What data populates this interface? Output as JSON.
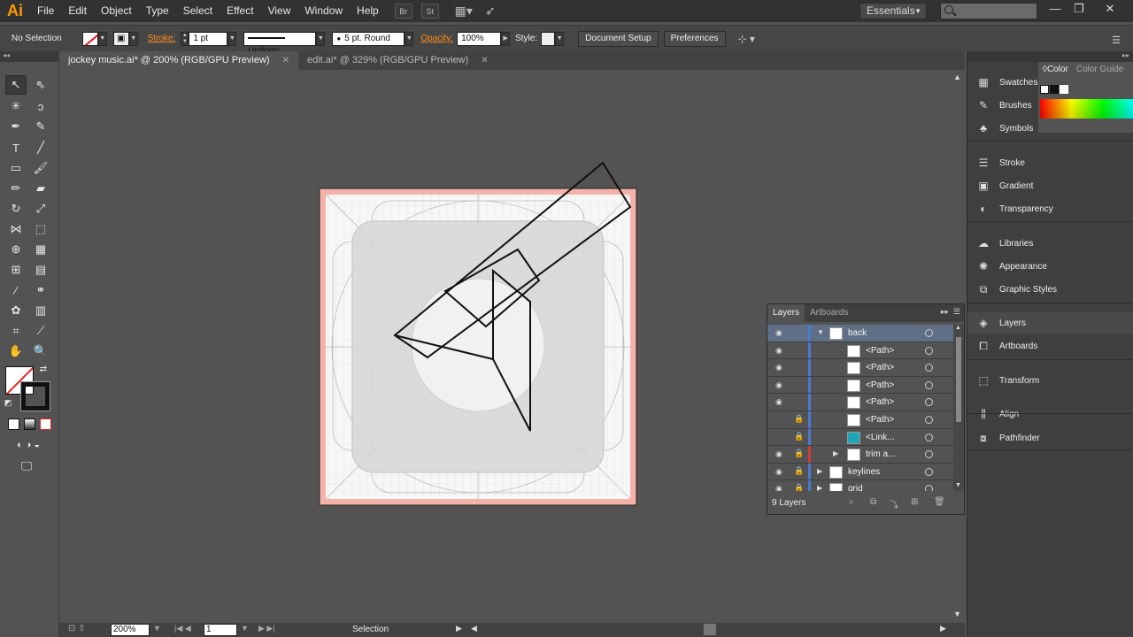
{
  "app": {
    "logo": "Ai",
    "menu": [
      "File",
      "Edit",
      "Object",
      "Type",
      "Select",
      "Effect",
      "View",
      "Window",
      "Help"
    ],
    "bridge_label": "Br",
    "stock_label": "St",
    "workspace": "Essentials"
  },
  "control_bar": {
    "selection_status": "No Selection",
    "stroke_label": "Stroke:",
    "stroke_weight": "1 pt",
    "stroke_profile": "Uniform",
    "brush": "5 pt. Round",
    "opacity_label": "Opacity:",
    "opacity": "100%",
    "style_label": "Style:",
    "document_setup": "Document Setup",
    "preferences": "Preferences"
  },
  "tabs": [
    {
      "label": "jockey music.ai* @ 200% (RGB/GPU Preview)",
      "active": true
    },
    {
      "label": "edit.ai* @ 329% (RGB/GPU Preview)",
      "active": false
    }
  ],
  "status_bar": {
    "zoom": "200%",
    "artboard": "1",
    "mode": "Selection"
  },
  "dock": {
    "color_panel": {
      "tabs": [
        "Color",
        "Color Guide"
      ]
    },
    "items": [
      {
        "label": "Swatches",
        "icon": "grid-icon"
      },
      {
        "label": "Brushes",
        "icon": "brush-icon"
      },
      {
        "label": "Symbols",
        "icon": "club-icon"
      },
      {
        "label": "Stroke",
        "icon": "stroke-icon"
      },
      {
        "label": "Gradient",
        "icon": "gradient-icon"
      },
      {
        "label": "Transparency",
        "icon": "transparency-icon"
      },
      {
        "label": "Libraries",
        "icon": "cloud-icon"
      },
      {
        "label": "Appearance",
        "icon": "appearance-icon"
      },
      {
        "label": "Graphic Styles",
        "icon": "graphic-styles-icon"
      },
      {
        "label": "Layers",
        "icon": "layers-icon"
      },
      {
        "label": "Artboards",
        "icon": "artboards-icon"
      },
      {
        "label": "Transform",
        "icon": "transform-icon"
      },
      {
        "label": "Align",
        "icon": "align-icon"
      },
      {
        "label": "Pathfinder",
        "icon": "pathfinder-icon"
      }
    ]
  },
  "layers_panel": {
    "tabs": [
      "Layers",
      "Artboards"
    ],
    "rows": [
      {
        "name": "back",
        "depth": 0,
        "expanded": true,
        "locked": false,
        "visible": true,
        "selected": true,
        "color": "#4a7bd3"
      },
      {
        "name": "<Path>",
        "depth": 1,
        "locked": false,
        "visible": true,
        "color": "#4a7bd3"
      },
      {
        "name": "<Path>",
        "depth": 1,
        "locked": false,
        "visible": true,
        "color": "#4a7bd3"
      },
      {
        "name": "<Path>",
        "depth": 1,
        "locked": false,
        "visible": true,
        "color": "#4a7bd3"
      },
      {
        "name": "<Path>",
        "depth": 1,
        "locked": false,
        "visible": true,
        "color": "#4a7bd3"
      },
      {
        "name": "<Path>",
        "depth": 1,
        "locked": true,
        "visible": false,
        "color": "#4a7bd3"
      },
      {
        "name": "<Link...",
        "depth": 1,
        "locked": true,
        "visible": false,
        "color": "#4a7bd3",
        "linked": true
      },
      {
        "name": "trim a...",
        "depth": 1,
        "locked": true,
        "visible": true,
        "collapsed": true,
        "color": "#d33a3a"
      },
      {
        "name": "keylines",
        "depth": 0,
        "locked": true,
        "visible": true,
        "collapsed": true,
        "color": "#4a7bd3"
      },
      {
        "name": "grid",
        "depth": 0,
        "locked": true,
        "visible": true,
        "collapsed": true,
        "color": "#4a7bd3"
      }
    ],
    "footer": "9 Layers"
  }
}
